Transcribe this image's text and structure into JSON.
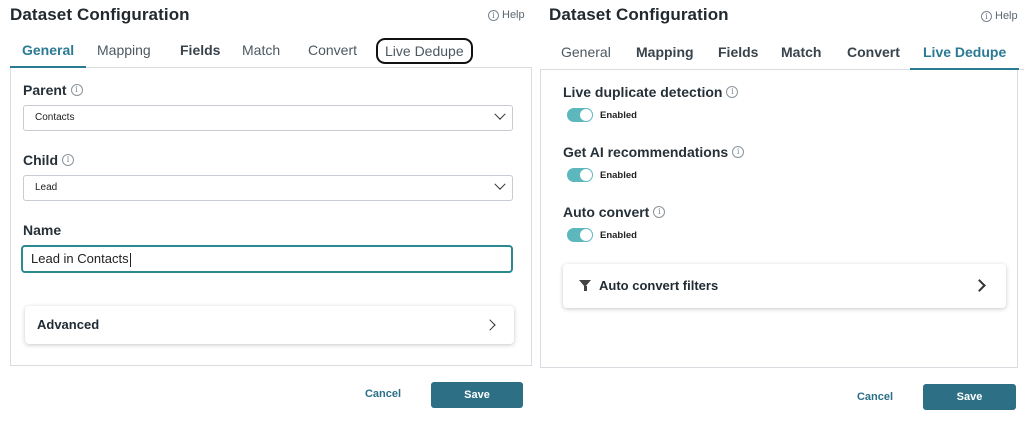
{
  "left": {
    "title": "Dataset Configuration",
    "help": "Help",
    "tabs": [
      "General",
      "Mapping",
      "Fields",
      "Match",
      "Convert",
      "Live Dedupe"
    ],
    "parent_label": "Parent",
    "parent_value": "Contacts",
    "child_label": "Child",
    "child_value": "Lead",
    "name_label": "Name",
    "name_value": "Lead in Contacts",
    "advanced_label": "Advanced",
    "cancel": "Cancel",
    "save": "Save"
  },
  "right": {
    "title": "Dataset Configuration",
    "help": "Help",
    "tabs": [
      "General",
      "Mapping",
      "Fields",
      "Match",
      "Convert",
      "Live Dedupe"
    ],
    "live_dup_label": "Live duplicate detection",
    "live_dup_state": "Enabled",
    "ai_rec_label": "Get AI recommendations",
    "ai_rec_state": "Enabled",
    "auto_convert_label": "Auto convert",
    "auto_convert_state": "Enabled",
    "filters_label": "Auto convert filters",
    "cancel": "Cancel",
    "save": "Save"
  },
  "colors": {
    "accent": "#2b7a93",
    "save_button": "#2d6f85",
    "toggle_on": "#5cb8bd",
    "input_focus": "#2b8a8f"
  },
  "icons": [
    "info-icon",
    "chevron-down-icon",
    "chevron-right-icon",
    "filter-icon"
  ]
}
